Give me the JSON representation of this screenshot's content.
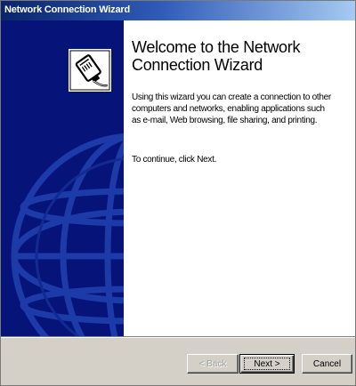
{
  "window": {
    "title": "Network Connection Wizard"
  },
  "banner": {
    "icon": "network-cable-plug-icon",
    "color": "#06147a"
  },
  "content": {
    "heading": "Welcome to the Network Connection Wizard",
    "intro": "Using this wizard you can create a connection to other computers and networks, enabling applications such as e-mail, Web browsing, file sharing, and printing.",
    "continue": "To continue, click Next."
  },
  "buttons": {
    "back": "< Back",
    "next": "Next >",
    "cancel": "Cancel"
  }
}
